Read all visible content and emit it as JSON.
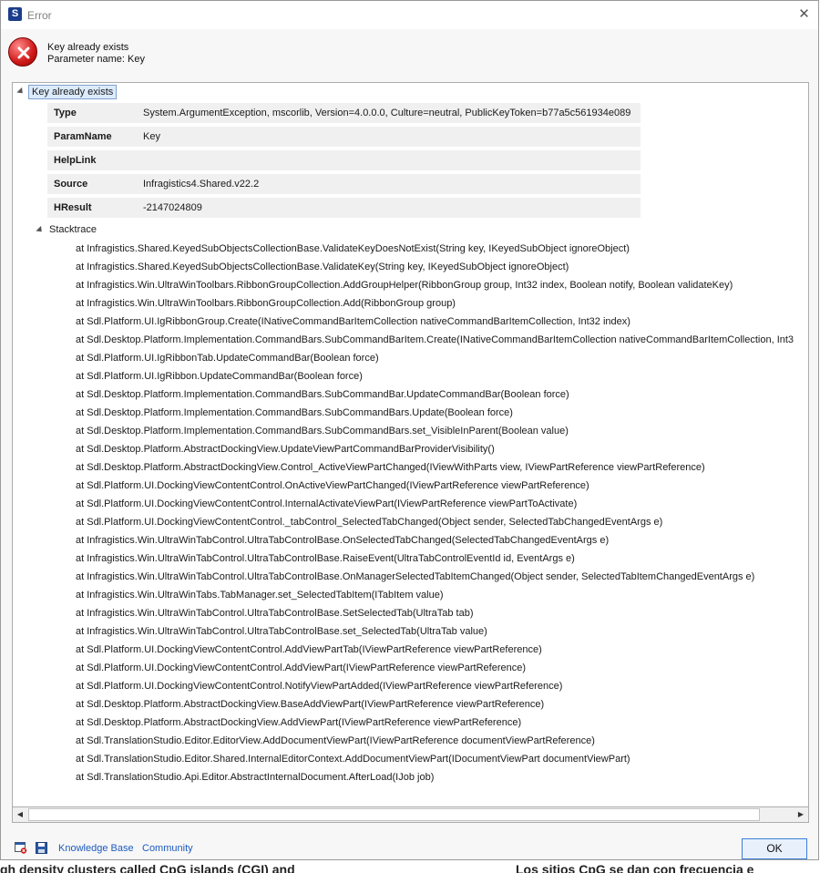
{
  "window": {
    "title": "Error",
    "app_icon_letter": "S",
    "close_glyph": "✕"
  },
  "header": {
    "icon": "error-icon",
    "message_line1": "Key already exists",
    "message_line2": "Parameter name: Key"
  },
  "tree": {
    "root_label": "Key already exists",
    "properties": [
      {
        "key": "Type",
        "value": "System.ArgumentException, mscorlib, Version=4.0.0.0, Culture=neutral, PublicKeyToken=b77a5c561934e089"
      },
      {
        "key": "ParamName",
        "value": "Key"
      },
      {
        "key": "HelpLink",
        "value": ""
      },
      {
        "key": "Source",
        "value": "Infragistics4.Shared.v22.2"
      },
      {
        "key": "HResult",
        "value": "-2147024809"
      }
    ],
    "stacktrace_label": "Stacktrace",
    "stacktrace": [
      "at Infragistics.Shared.KeyedSubObjectsCollectionBase.ValidateKeyDoesNotExist(String key, IKeyedSubObject ignoreObject)",
      "at Infragistics.Shared.KeyedSubObjectsCollectionBase.ValidateKey(String key, IKeyedSubObject ignoreObject)",
      "at Infragistics.Win.UltraWinToolbars.RibbonGroupCollection.AddGroupHelper(RibbonGroup group, Int32 index, Boolean notify, Boolean validateKey)",
      "at Infragistics.Win.UltraWinToolbars.RibbonGroupCollection.Add(RibbonGroup group)",
      "at Sdl.Platform.UI.IgRibbonGroup.Create(INativeCommandBarItemCollection nativeCommandBarItemCollection, Int32 index)",
      "at Sdl.Desktop.Platform.Implementation.CommandBars.SubCommandBarItem.Create(INativeCommandBarItemCollection nativeCommandBarItemCollection, Int3",
      "at Sdl.Platform.UI.IgRibbonTab.UpdateCommandBar(Boolean force)",
      "at Sdl.Platform.UI.IgRibbon.UpdateCommandBar(Boolean force)",
      "at Sdl.Desktop.Platform.Implementation.CommandBars.SubCommandBar.UpdateCommandBar(Boolean force)",
      "at Sdl.Desktop.Platform.Implementation.CommandBars.SubCommandBars.Update(Boolean force)",
      "at Sdl.Desktop.Platform.Implementation.CommandBars.SubCommandBars.set_VisibleInParent(Boolean value)",
      "at Sdl.Desktop.Platform.AbstractDockingView.UpdateViewPartCommandBarProviderVisibility()",
      "at Sdl.Desktop.Platform.AbstractDockingView.Control_ActiveViewPartChanged(IViewWithParts view, IViewPartReference viewPartReference)",
      "at Sdl.Platform.UI.DockingViewContentControl.OnActiveViewPartChanged(IViewPartReference viewPartReference)",
      "at Sdl.Platform.UI.DockingViewContentControl.InternalActivateViewPart(IViewPartReference viewPartToActivate)",
      "at Sdl.Platform.UI.DockingViewContentControl._tabControl_SelectedTabChanged(Object sender, SelectedTabChangedEventArgs e)",
      "at Infragistics.Win.UltraWinTabControl.UltraTabControlBase.OnSelectedTabChanged(SelectedTabChangedEventArgs e)",
      "at Infragistics.Win.UltraWinTabControl.UltraTabControlBase.RaiseEvent(UltraTabControlEventId id, EventArgs e)",
      "at Infragistics.Win.UltraWinTabControl.UltraTabControlBase.OnManagerSelectedTabItemChanged(Object sender, SelectedTabItemChangedEventArgs e)",
      "at Infragistics.Win.UltraWinTabs.TabManager.set_SelectedTabItem(ITabItem value)",
      "at Infragistics.Win.UltraWinTabControl.UltraTabControlBase.SetSelectedTab(UltraTab tab)",
      "at Infragistics.Win.UltraWinTabControl.UltraTabControlBase.set_SelectedTab(UltraTab value)",
      "at Sdl.Platform.UI.DockingViewContentControl.AddViewPartTab(IViewPartReference viewPartReference)",
      "at Sdl.Platform.UI.DockingViewContentControl.AddViewPart(IViewPartReference viewPartReference)",
      "at Sdl.Platform.UI.DockingViewContentControl.NotifyViewPartAdded(IViewPartReference viewPartReference)",
      "at Sdl.Desktop.Platform.AbstractDockingView.BaseAddViewPart(IViewPartReference viewPartReference)",
      "at Sdl.Desktop.Platform.AbstractDockingView.AddViewPart(IViewPartReference viewPartReference)",
      "at Sdl.TranslationStudio.Editor.EditorView.AddDocumentViewPart(IViewPartReference documentViewPartReference)",
      "at Sdl.TranslationStudio.Editor.Shared.InternalEditorContext.AddDocumentViewPart(IDocumentViewPart documentViewPart)",
      "at Sdl.TranslationStudio.Api.Editor.AbstractInternalDocument.AfterLoad(IJob job)"
    ]
  },
  "footer": {
    "icons": [
      "close-window-icon",
      "save-icon"
    ],
    "knowledge_base_label": "Knowledge Base",
    "community_label": "Community",
    "ok_label": "OK"
  },
  "background_text": {
    "left": "gh density clusters called CpG islands (CGI) and",
    "right": "Los sitios CpG se dan con frecuencia e"
  }
}
